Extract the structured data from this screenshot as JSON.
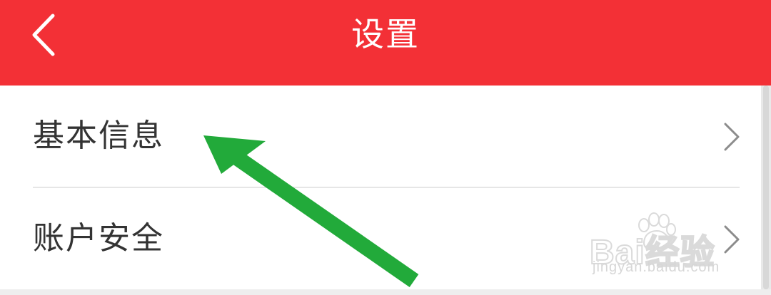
{
  "header": {
    "title": "设置",
    "background_color": "#f33036",
    "back_icon": "chevron-left-icon"
  },
  "settings_list": {
    "items": [
      {
        "label": "基本信息",
        "icon": "chevron-right-icon"
      },
      {
        "label": "账户安全",
        "icon": "chevron-right-icon"
      }
    ]
  },
  "annotation": {
    "arrow_color": "#22aa3a",
    "arrow_icon": "annotation-arrow"
  },
  "watermark": {
    "brand": "Bai经验",
    "url": "jingyan.baidu.com",
    "icon": "baidu-paw-icon"
  }
}
